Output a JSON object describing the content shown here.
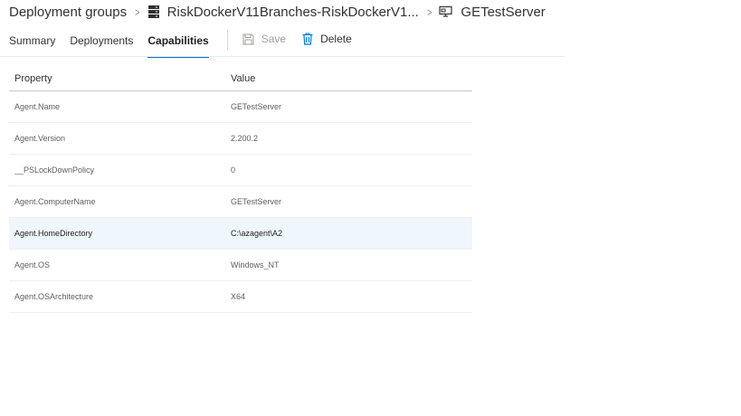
{
  "breadcrumb": {
    "items": [
      {
        "label": "Deployment groups"
      },
      {
        "label": "RiskDockerV11Branches-RiskDockerV1..."
      },
      {
        "label": "GETestServer"
      }
    ],
    "separator": ">"
  },
  "tabs": [
    {
      "label": "Summary",
      "active": false
    },
    {
      "label": "Deployments",
      "active": false
    },
    {
      "label": "Capabilities",
      "active": true
    }
  ],
  "toolbar": {
    "save_label": "Save",
    "delete_label": "Delete"
  },
  "table": {
    "columns": [
      "Property",
      "Value"
    ],
    "rows": [
      {
        "property": "Agent.Name",
        "value": "GETestServer"
      },
      {
        "property": "Agent.Version",
        "value": "2.200.2"
      },
      {
        "property": "__PSLockDownPolicy",
        "value": "0"
      },
      {
        "property": "Agent.ComputerName",
        "value": "GETestServer"
      },
      {
        "property": "Agent.HomeDirectory",
        "value": "C:\\azagent\\A2"
      },
      {
        "property": "Agent.OS",
        "value": "Windows_NT"
      },
      {
        "property": "Agent.OSArchitecture",
        "value": "X64"
      }
    ],
    "selected_row": 4
  },
  "colors": {
    "accent": "#0078d4",
    "selected_row_bg": "#eff6fc",
    "text": "#323130",
    "muted_text": "#605e5c"
  }
}
